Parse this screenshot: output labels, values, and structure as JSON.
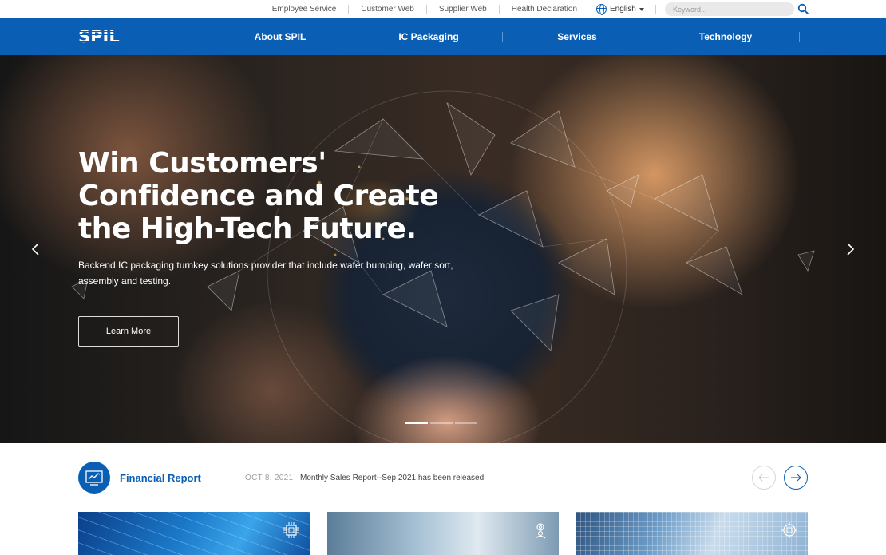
{
  "utility": {
    "links": [
      "Employee Service",
      "Customer Web",
      "Supplier Web",
      "Health Declaration"
    ],
    "language": "English",
    "search_placeholder": "Keyword..."
  },
  "nav": {
    "logo": "SPIL",
    "items": [
      "About SPIL",
      "IC Packaging",
      "Services",
      "Technology"
    ]
  },
  "hero": {
    "title": "Win Customers' Confidence and Create the High-Tech Future.",
    "subtitle": "Backend IC packaging turnkey solutions provider that include wafer bumping, wafer sort, assembly and testing.",
    "button": "Learn More",
    "slides_count": 3,
    "active_slide": 1
  },
  "news": {
    "section_title": "Financial Report",
    "date": "OCT 8, 2021",
    "headline": "Monthly Sales Report--Sep 2021 has been released"
  },
  "cards": [
    {
      "icon": "chip-icon"
    },
    {
      "icon": "engineer-gear-icon"
    },
    {
      "icon": "wafer-chip-icon"
    }
  ],
  "colors": {
    "brand_blue": "#0a5fb4"
  }
}
